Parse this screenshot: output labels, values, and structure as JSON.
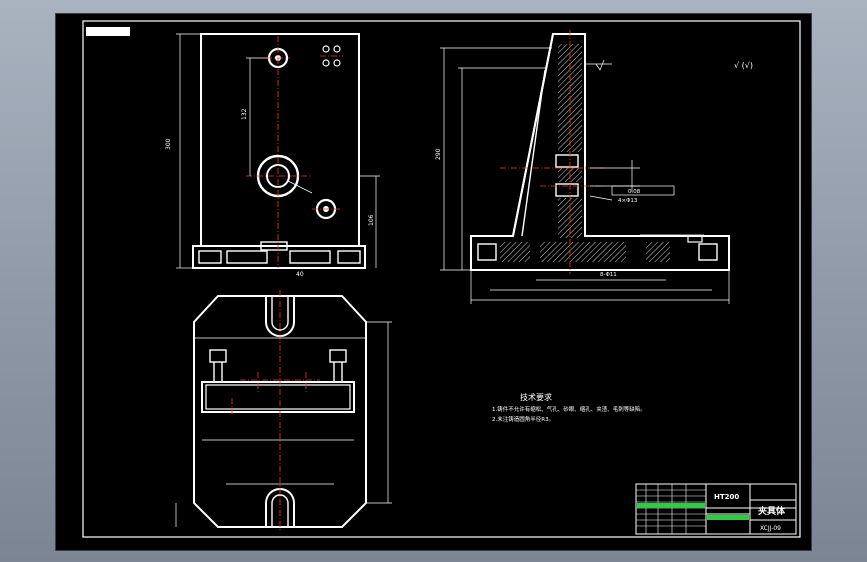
{
  "surface_finish": "√ (√)",
  "dims": {
    "front_hole_spacing": "132",
    "front_total_height": "300",
    "front_lower_height": "106",
    "front_base_width": "40",
    "side_total_height": "290",
    "side_angle": "4×Φ13",
    "side_tolerance": "0.08",
    "side_base": "8-Φ11"
  },
  "notes": {
    "title": "技术要求",
    "line1": "1.铸件不允许有缩松、气孔、砂眼、缩孔、夹渣、毛刺等缺陷。",
    "line2": "2.未注铸造圆角半径R3。"
  },
  "title_block": {
    "material": "HT200",
    "part_name": "夹具体",
    "drawing_no": "XCJJ-09"
  }
}
